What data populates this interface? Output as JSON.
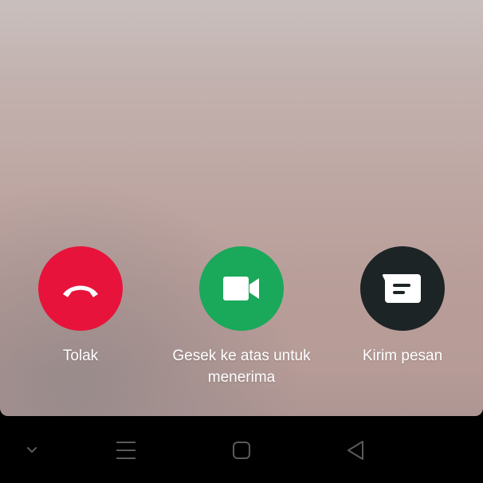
{
  "call_actions": {
    "decline_label": "Tolak",
    "accept_label": "Gesek ke atas untuk menerima",
    "message_label": "Kirim pesan"
  },
  "colors": {
    "decline": "#e8133b",
    "accept": "#1aa85a",
    "message": "#1d2426"
  },
  "icons": {
    "decline": "phone-hangup-icon",
    "accept": "video-camera-icon",
    "message": "message-bubble-icon"
  },
  "navbar": {
    "icons": [
      "chevron-down-icon",
      "recent-apps-icon",
      "home-icon",
      "back-icon"
    ]
  }
}
